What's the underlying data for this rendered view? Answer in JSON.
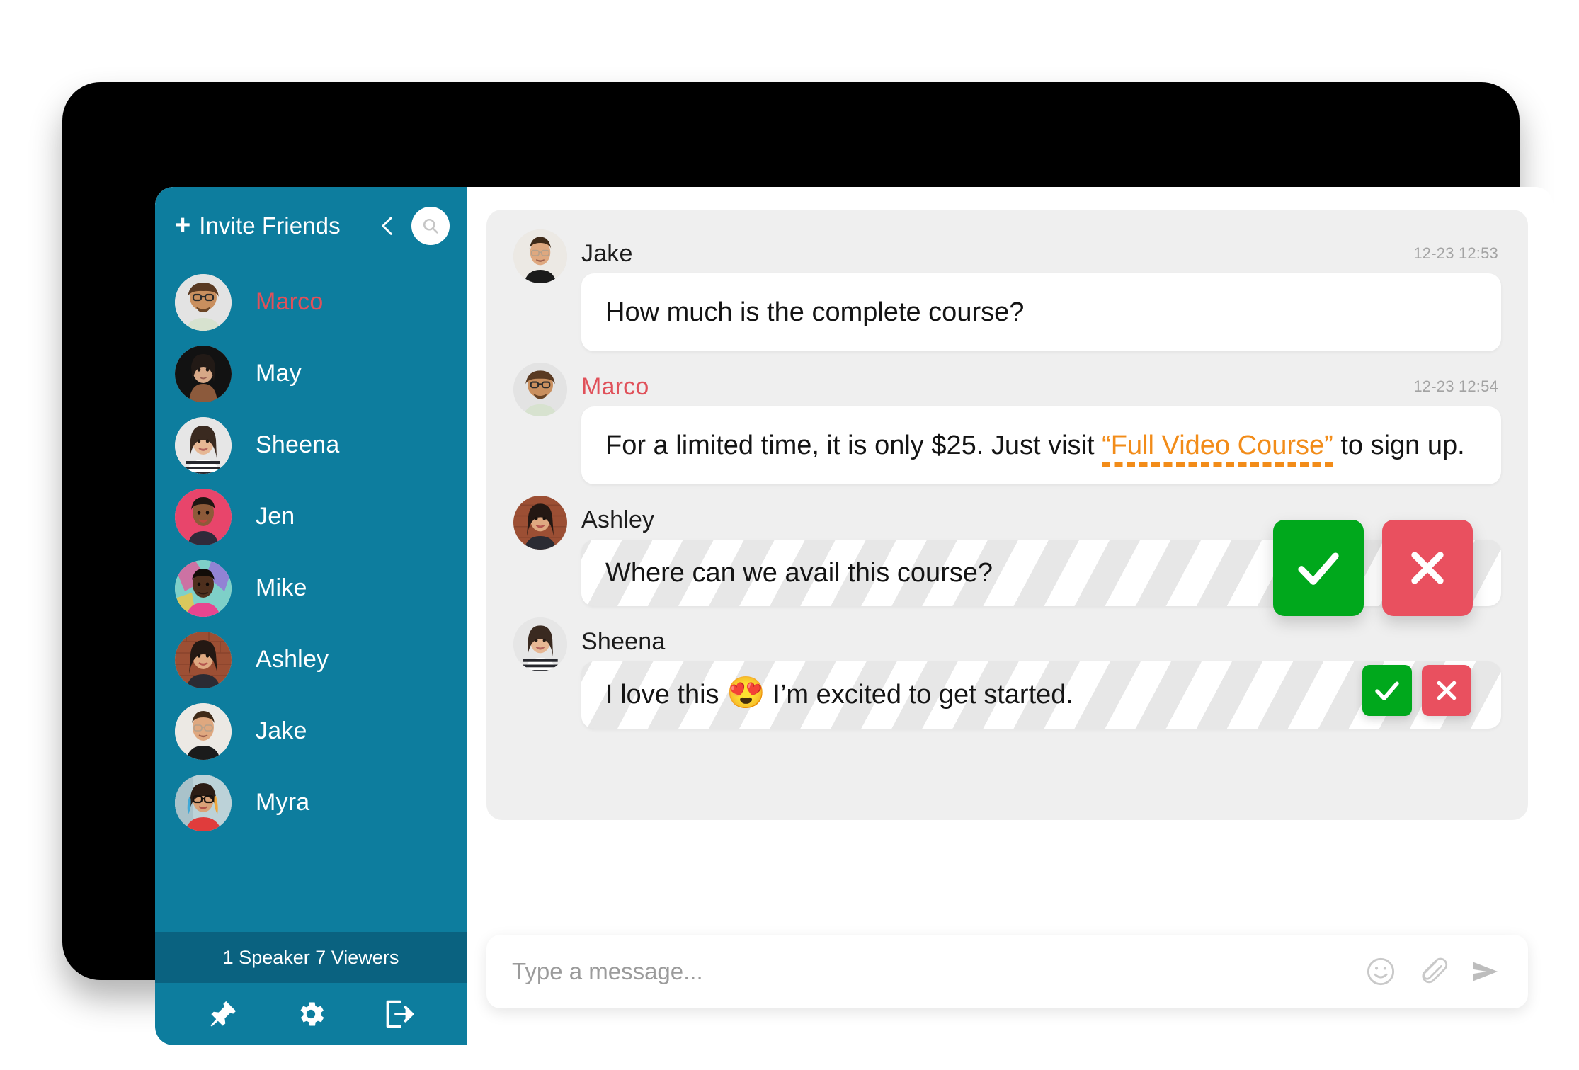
{
  "sidebar": {
    "invite_label": "Invite Friends",
    "plus_icon": "plus-icon",
    "collapse_icon": "chevron-left-icon",
    "search_icon": "search-icon",
    "contacts": [
      {
        "name": "Marco",
        "active": true
      },
      {
        "name": "May",
        "active": false
      },
      {
        "name": "Sheena",
        "active": false
      },
      {
        "name": "Jen",
        "active": false
      },
      {
        "name": "Mike",
        "active": false
      },
      {
        "name": "Ashley",
        "active": false
      },
      {
        "name": "Jake",
        "active": false
      },
      {
        "name": "Myra",
        "active": false
      }
    ],
    "status_text": "1 Speaker 7 Viewers",
    "footer_icons": [
      "pin-icon",
      "gear-icon",
      "logout-icon"
    ]
  },
  "chat": {
    "messages": [
      {
        "author": "Jake",
        "accent": false,
        "time": "12-23 12:53",
        "text": "How much is the complete course?",
        "striped": false,
        "actions": "none"
      },
      {
        "author": "Marco",
        "accent": true,
        "time": "12-23 12:54",
        "text_before": "For a limited time, it is only $25. Just visit ",
        "link_text": "“Full Video Course”",
        "text_after": " to sign up.",
        "striped": false,
        "actions": "none"
      },
      {
        "author": "Ashley",
        "accent": false,
        "time": "",
        "text": "Where can we avail this course?",
        "striped": true,
        "actions": "big"
      },
      {
        "author": "Sheena",
        "accent": false,
        "time": "",
        "text_before": "I love this ",
        "emoji": "😍",
        "text_after": " I’m excited to get started.",
        "striped": true,
        "actions": "small"
      }
    ],
    "approve_icon": "checkmark-icon",
    "reject_icon": "cross-icon"
  },
  "composer": {
    "placeholder": "Type a message...",
    "value": "",
    "emoji_icon": "smiley-icon",
    "attach_icon": "paperclip-icon",
    "send_icon": "send-icon"
  },
  "colors": {
    "sidebar_bg": "#0d7d9e",
    "status_bar_bg": "#0a6280",
    "accent_red": "#e0515a",
    "link_orange": "#f28c19",
    "approve_green": "#00a81c",
    "reject_red": "#e9505f",
    "panel_bg": "#efefef",
    "frame_black": "#000000"
  }
}
